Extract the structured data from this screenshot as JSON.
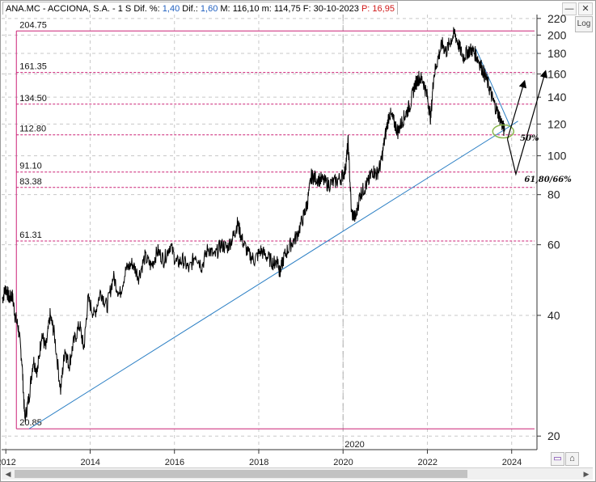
{
  "infobar": {
    "symbol": "ANA.MC - ACCIONA, S.A. -",
    "period": "1 S",
    "dif_pct_label": "Dif. %:",
    "dif_pct_value": "1,40",
    "dif_label": "Dif.:",
    "dif_value": "1,60",
    "m_label": "M:",
    "m_value": "116,10",
    "m2_label": "m:",
    "m2_value": "114,75",
    "f_label": "F:",
    "f_value": "30-10-2023",
    "p_label": "P:",
    "p_value": "16,95"
  },
  "window_buttons": {
    "min": "—",
    "close": "✕"
  },
  "log_button": "Log",
  "scrollbar": {
    "left": "◀",
    "right": "▶"
  },
  "tools": [
    "▭",
    "⌂"
  ],
  "chart_data": {
    "type": "line",
    "title": "",
    "xlabel": "",
    "ylabel": "",
    "y_scale": "log",
    "ylim": [
      18.5,
      225
    ],
    "x_range": [
      2011.9,
      2024.6
    ],
    "yticks": [
      20,
      40,
      60,
      80,
      100,
      120,
      140,
      160,
      180,
      200,
      220
    ],
    "xticks": [
      2012,
      2014,
      2016,
      2018,
      2020,
      2022,
      2024
    ],
    "x_marker": "2020",
    "grid": true,
    "colors": {
      "price": "#000000",
      "fib": "#cc2277",
      "trend": "#2b7fc4",
      "annotation": "#000000",
      "ellipse": "#8ab84e",
      "grid": "#c8c8c8"
    },
    "price_series": [
      [
        2011.92,
        44
      ],
      [
        2012.0,
        47
      ],
      [
        2012.08,
        44
      ],
      [
        2012.15,
        45
      ],
      [
        2012.22,
        40
      ],
      [
        2012.3,
        37
      ],
      [
        2012.38,
        31
      ],
      [
        2012.45,
        22
      ],
      [
        2012.55,
        25
      ],
      [
        2012.65,
        31
      ],
      [
        2012.75,
        29
      ],
      [
        2012.85,
        36
      ],
      [
        2012.95,
        33
      ],
      [
        2013.05,
        40
      ],
      [
        2013.15,
        36
      ],
      [
        2013.3,
        26
      ],
      [
        2013.4,
        33
      ],
      [
        2013.5,
        30
      ],
      [
        2013.6,
        34
      ],
      [
        2013.75,
        38
      ],
      [
        2013.85,
        33
      ],
      [
        2013.95,
        44
      ],
      [
        2014.1,
        40
      ],
      [
        2014.25,
        46
      ],
      [
        2014.4,
        42
      ],
      [
        2014.55,
        50
      ],
      [
        2014.7,
        45
      ],
      [
        2014.85,
        52
      ],
      [
        2015.0,
        54
      ],
      [
        2015.15,
        50
      ],
      [
        2015.3,
        56
      ],
      [
        2015.45,
        53
      ],
      [
        2015.6,
        58
      ],
      [
        2015.75,
        55
      ],
      [
        2015.9,
        60
      ],
      [
        2016.05,
        54
      ],
      [
        2016.2,
        55
      ],
      [
        2016.35,
        52
      ],
      [
        2016.5,
        57
      ],
      [
        2016.65,
        53
      ],
      [
        2016.8,
        59
      ],
      [
        2016.95,
        56
      ],
      [
        2017.1,
        60
      ],
      [
        2017.25,
        59
      ],
      [
        2017.4,
        63
      ],
      [
        2017.5,
        68
      ],
      [
        2017.6,
        62
      ],
      [
        2017.75,
        57
      ],
      [
        2017.9,
        55
      ],
      [
        2018.05,
        58
      ],
      [
        2018.2,
        56
      ],
      [
        2018.35,
        54
      ],
      [
        2018.45,
        55
      ],
      [
        2018.5,
        51
      ],
      [
        2018.6,
        56
      ],
      [
        2018.75,
        60
      ],
      [
        2018.9,
        63
      ],
      [
        2019.05,
        70
      ],
      [
        2019.15,
        76
      ],
      [
        2019.25,
        89
      ],
      [
        2019.35,
        88
      ],
      [
        2019.5,
        87
      ],
      [
        2019.65,
        85
      ],
      [
        2019.8,
        86
      ],
      [
        2019.95,
        88
      ],
      [
        2020.05,
        92
      ],
      [
        2020.12,
        108
      ],
      [
        2020.2,
        72
      ],
      [
        2020.3,
        70
      ],
      [
        2020.4,
        80
      ],
      [
        2020.5,
        83
      ],
      [
        2020.6,
        86
      ],
      [
        2020.7,
        92
      ],
      [
        2020.8,
        90
      ],
      [
        2020.9,
        96
      ],
      [
        2021.0,
        112
      ],
      [
        2021.1,
        128
      ],
      [
        2021.2,
        122
      ],
      [
        2021.3,
        115
      ],
      [
        2021.4,
        122
      ],
      [
        2021.5,
        128
      ],
      [
        2021.6,
        135
      ],
      [
        2021.7,
        150
      ],
      [
        2021.8,
        157
      ],
      [
        2021.9,
        154
      ],
      [
        2022.0,
        140
      ],
      [
        2022.08,
        124
      ],
      [
        2022.15,
        158
      ],
      [
        2022.25,
        175
      ],
      [
        2022.35,
        190
      ],
      [
        2022.45,
        182
      ],
      [
        2022.55,
        194
      ],
      [
        2022.65,
        202
      ],
      [
        2022.75,
        188
      ],
      [
        2022.85,
        176
      ],
      [
        2022.95,
        182
      ],
      [
        2023.05,
        184
      ],
      [
        2023.15,
        179
      ],
      [
        2023.25,
        170
      ],
      [
        2023.35,
        160
      ],
      [
        2023.45,
        150
      ],
      [
        2023.55,
        138
      ],
      [
        2023.65,
        130
      ],
      [
        2023.75,
        122
      ],
      [
        2023.83,
        115
      ]
    ],
    "fib_levels": [
      {
        "label": "204.75",
        "value": 204.75,
        "style": "solid"
      },
      {
        "label": "161.35",
        "value": 161.35,
        "style": "dashed"
      },
      {
        "label": "134.50",
        "value": 134.5,
        "style": "dashed"
      },
      {
        "label": "112.80",
        "value": 112.8,
        "style": "dashed"
      },
      {
        "label": "91.10",
        "value": 91.1,
        "style": "dashed"
      },
      {
        "label": "83.38",
        "value": 83.38,
        "style": "dashed"
      },
      {
        "label": "61.31",
        "value": 61.31,
        "style": "dashed"
      },
      {
        "label": "20.85",
        "value": 20.85,
        "style": "solid"
      }
    ],
    "fib_box_x": [
      2012.25,
      2024.6
    ],
    "trendline": [
      [
        2012.55,
        20.85
      ],
      [
        2024.15,
        122
      ]
    ],
    "downtrend": [
      [
        2023.15,
        185
      ],
      [
        2023.97,
        118
      ]
    ],
    "ellipse_center": [
      2023.8,
      115
    ],
    "projections": [
      {
        "path": [
          [
            2023.9,
            110
          ],
          [
            2024.3,
            153
          ]
        ]
      },
      {
        "path": [
          [
            2023.9,
            110
          ],
          [
            2024.1,
            90
          ],
          [
            2024.8,
            162
          ]
        ]
      }
    ],
    "annotations": [
      {
        "text": "50%",
        "x": 2024.2,
        "y": 109
      },
      {
        "text": "61,80/66%",
        "x": 2024.3,
        "y": 86
      }
    ]
  }
}
